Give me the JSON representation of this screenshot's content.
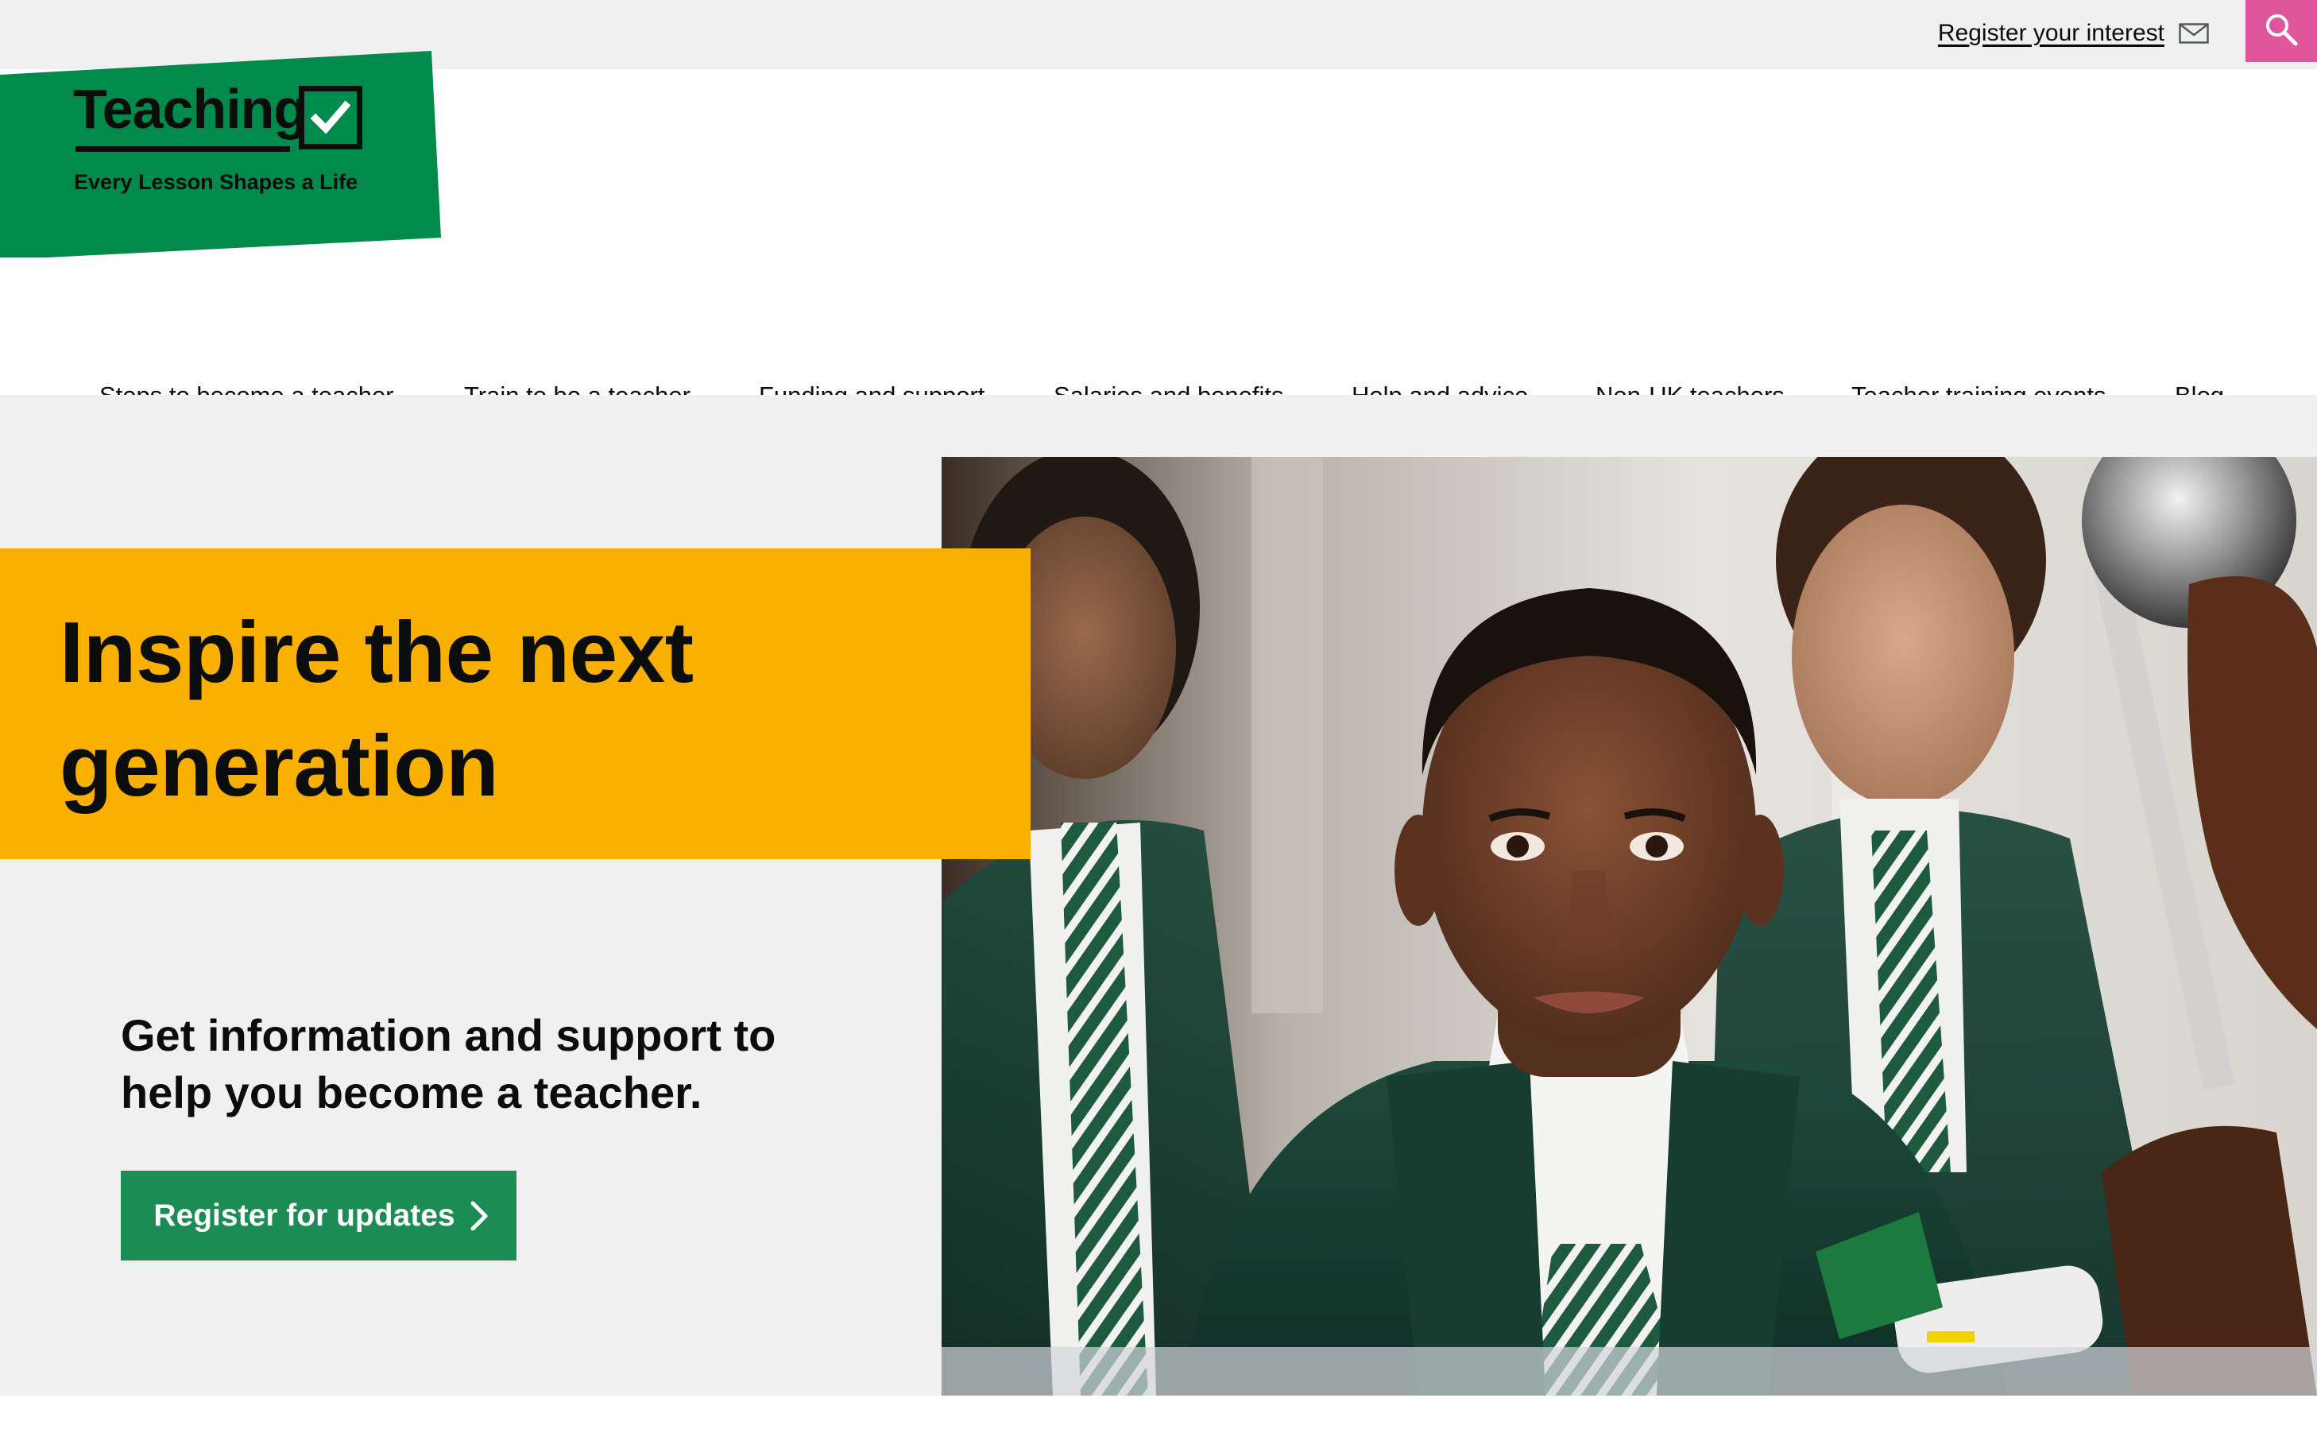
{
  "utility_bar": {
    "register_interest_label": "Register your interest",
    "envelope_icon": "envelope-icon",
    "search_icon": "search-icon",
    "search_button_color": "#e0569d"
  },
  "logo": {
    "wordmark": "Teaching",
    "tagline": "Every Lesson Shapes a Life",
    "check_icon": "checkbox-tick-icon",
    "brand_color": "#008a4c"
  },
  "nav": {
    "items": [
      {
        "label": "Steps to become a teacher"
      },
      {
        "label": "Train to be a teacher"
      },
      {
        "label": "Funding and support"
      },
      {
        "label": "Salaries and benefits"
      },
      {
        "label": "Help and advice"
      },
      {
        "label": "Non-UK teachers"
      },
      {
        "label": "Teacher training events"
      },
      {
        "label": "Blog"
      }
    ]
  },
  "hero": {
    "heading": "Inspire the next generation",
    "subtext": "Get information and support to help you become a teacher.",
    "cta_label": "Register for updates",
    "cta_icon": "chevron-right-icon",
    "heading_box_color": "#f9b000",
    "cta_color": "#1c8c55",
    "photo_description_icon": "students-in-classroom-photo"
  }
}
